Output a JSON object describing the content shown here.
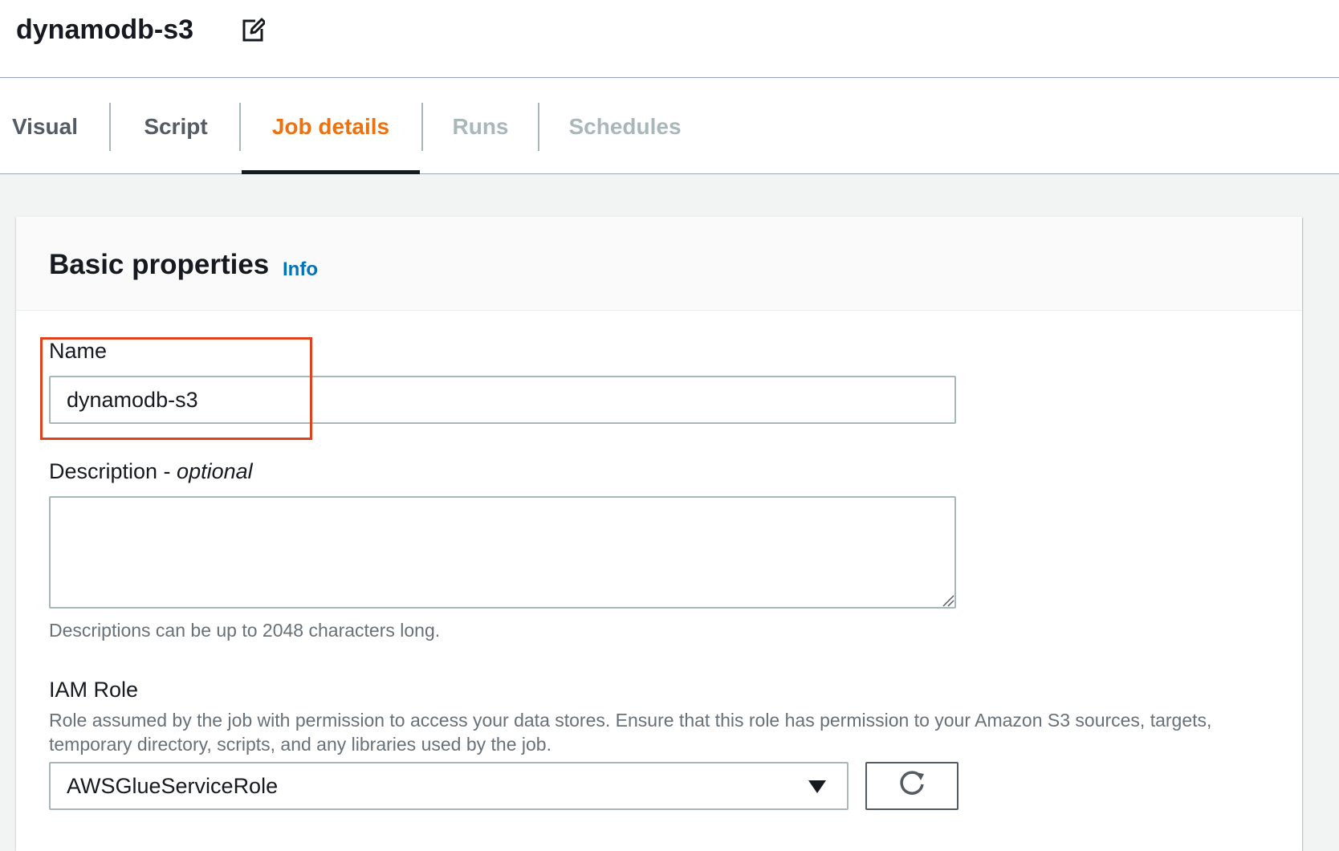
{
  "header": {
    "job_name": "dynamodb-s3"
  },
  "tabs": [
    {
      "label": "Visual",
      "state": "enabled"
    },
    {
      "label": "Script",
      "state": "enabled"
    },
    {
      "label": "Job details",
      "state": "active"
    },
    {
      "label": "Runs",
      "state": "disabled"
    },
    {
      "label": "Schedules",
      "state": "disabled"
    }
  ],
  "basic_properties": {
    "title": "Basic properties",
    "info_link": "Info",
    "name_field": {
      "label": "Name",
      "value": "dynamodb-s3"
    },
    "description_field": {
      "label": "Description - ",
      "label_suffix": "optional",
      "value": "",
      "hint": "Descriptions can be up to 2048 characters long."
    },
    "iam_role": {
      "label": "IAM Role",
      "description": "Role assumed by the job with permission to access your data stores. Ensure that this role has permission to your Amazon S3 sources, targets, temporary directory, scripts, and any libraries used by the job.",
      "selected": "AWSGlueServiceRole"
    }
  },
  "colors": {
    "accent_active_tab": "#ec7211",
    "link": "#0073bb",
    "highlight_box": "#e0421e"
  },
  "icons": {
    "edit": "edit-icon",
    "dropdown": "caret-down-icon",
    "refresh": "refresh-icon"
  }
}
